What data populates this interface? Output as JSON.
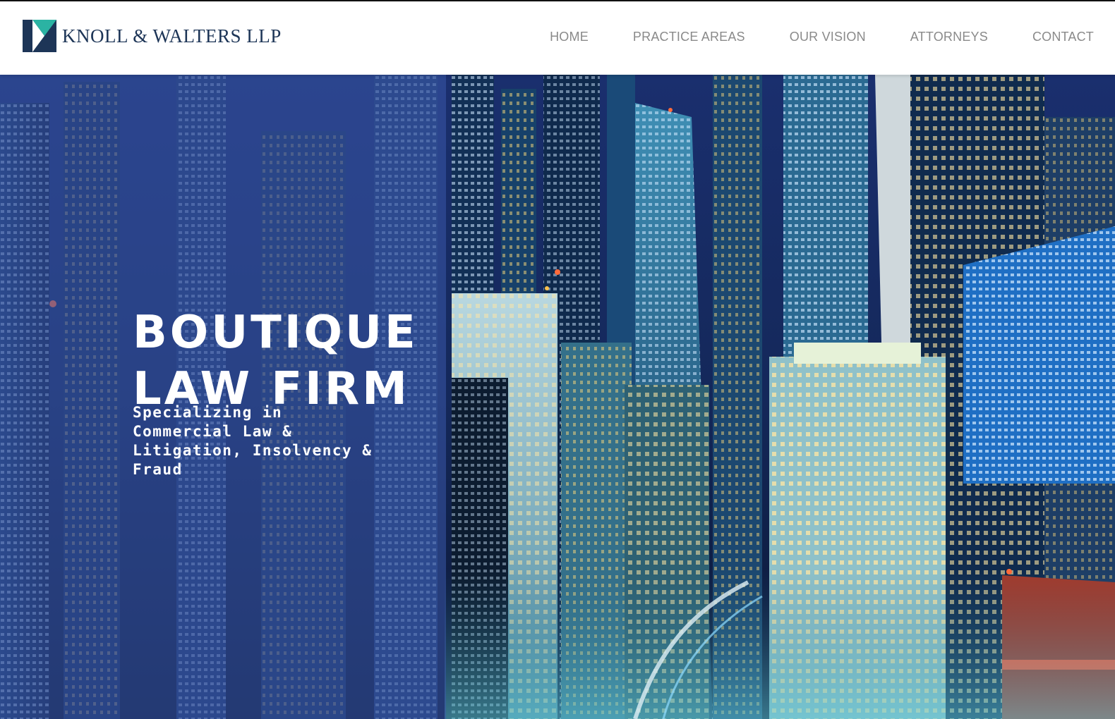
{
  "brand": {
    "name": "KNOLL & WALTERS LLP",
    "logo_colors": {
      "teal": "#2bb3a3",
      "navy": "#1d3557"
    }
  },
  "nav": {
    "items": [
      {
        "label": "HOME"
      },
      {
        "label": "PRACTICE AREAS"
      },
      {
        "label": "OUR VISION"
      },
      {
        "label": "ATTORNEYS"
      },
      {
        "label": "CONTACT"
      }
    ]
  },
  "hero": {
    "title_line1": "BOUTIQUE",
    "title_line2": "LAW FIRM",
    "subtitle": "Specializing in Commercial Law & Litigation, Insolvency & Fraud",
    "overlay_color": "#3a58aa"
  }
}
